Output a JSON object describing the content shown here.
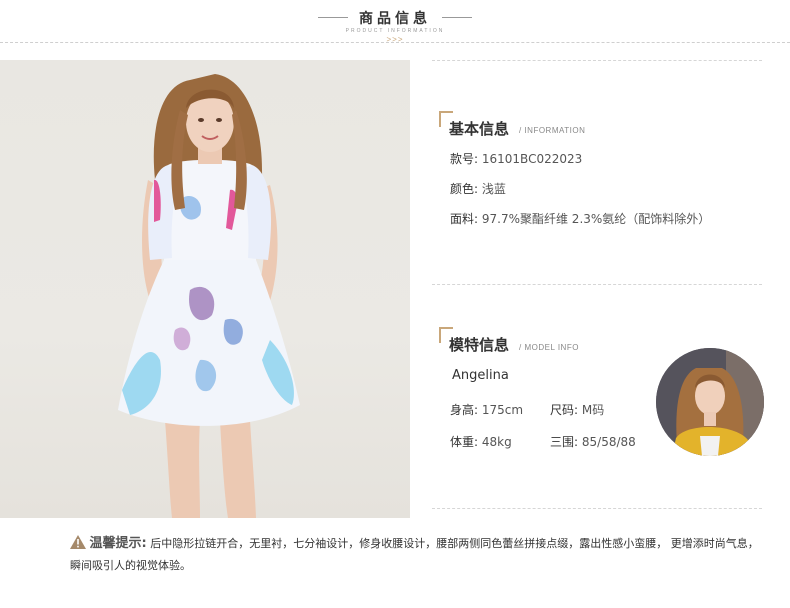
{
  "header": {
    "title": "商品信息",
    "subtitle": "PRODUCT INFORMATION",
    "arrows": ">>>"
  },
  "basic_info": {
    "title": "基本信息",
    "subtitle": "/ INFORMATION",
    "rows": [
      {
        "label": "款号:",
        "value": "16101BC022023"
      },
      {
        "label": "颜色:",
        "value": "浅蓝"
      },
      {
        "label": "面料:",
        "value": "97.7%聚酯纤维 2.3%氨纶（配饰料除外）"
      }
    ]
  },
  "model_info": {
    "title": "模特信息",
    "subtitle": "/ MODEL INFO",
    "name": "Angelina",
    "height_label": "身高:",
    "height_value": "175cm",
    "size_label": "尺码:",
    "size_value": "M码",
    "weight_label": "体重:",
    "weight_value": "48kg",
    "measure_label": "三围:",
    "measure_value": "85/58/88"
  },
  "notice": {
    "label": "温馨提示:",
    "text": "后中隐形拉链开合，无里衬，七分袖设计，修身收腰设计，腰部两侧同色蕾丝拼接点缀，露出性感小蛮腰，  更增添时尚气息，瞬间吸引人的视觉体验。"
  },
  "colors": {
    "accent": "#c9a77a",
    "background": "#ffffff",
    "text": "#333333"
  }
}
